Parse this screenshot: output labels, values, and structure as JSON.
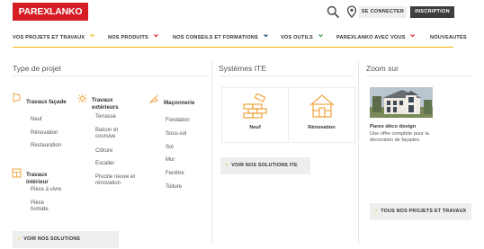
{
  "header": {
    "logo_text": "PAREXLANKO",
    "connect_label": "SE CONNECTER",
    "inscription_label": "INSCRIPTION"
  },
  "nav": {
    "items": [
      {
        "label": "VOS PROJETS ET TRAVAUX",
        "chevron": "up",
        "color": "#f1b90f"
      },
      {
        "label": "NOS PRODUITS",
        "chevron": "down",
        "color": "#d51c24"
      },
      {
        "label": "NOS CONSEILS ET FORMATIONS",
        "chevron": "down",
        "color": "#1f3f6e"
      },
      {
        "label": "VOS OUTILS",
        "chevron": "down",
        "color": "#2e9b4a"
      },
      {
        "label": "PAREXLANKO AVEC VOUS",
        "chevron": "down",
        "color": "#d51c24"
      },
      {
        "label": "NOUVEAUTÉS",
        "chevron": "none",
        "color": ""
      }
    ]
  },
  "type_projet": {
    "title": "Type de projet",
    "categories": {
      "facade": {
        "label": "Travaux façade",
        "items": [
          "Neuf",
          "Rénovation",
          "Restauration"
        ]
      },
      "exterieurs": {
        "label": "Travaux extérieurs",
        "items": [
          "Terrasse",
          "Balcon et coursive",
          "Clôture",
          "Escalier",
          "Piscine neuve et rénovation"
        ]
      },
      "maconnerie": {
        "label": "Maçonnerie",
        "items": [
          "Fondation",
          "Sous-sol",
          "Sol",
          "Mur",
          "Fenêtre",
          "Toiture"
        ]
      },
      "interieur": {
        "label": "Travaux intérieur",
        "items": [
          "Pièce à vivre",
          "Pièce humide"
        ]
      }
    },
    "cta": "VOIR NOS SOLUTIONS"
  },
  "systemes_ite": {
    "title": "Systèmes ITE",
    "tiles": [
      {
        "label": "Neuf",
        "icon": "brick-wall-icon"
      },
      {
        "label": "Rénovation",
        "icon": "house-icon"
      }
    ],
    "cta": "VOIR NOS SOLUTIONS ITE"
  },
  "zoom": {
    "title": "Zoom sur",
    "article_title": "Parex déco design",
    "article_text": "Une offre complète pour la décoration de façades.",
    "cta": "TOUS NOS PROJETS ET TRAVAUX"
  },
  "colors": {
    "brand_red": "#d51c24",
    "accent_yellow": "#f1b90f",
    "icon_orange": "#f0a43c"
  }
}
